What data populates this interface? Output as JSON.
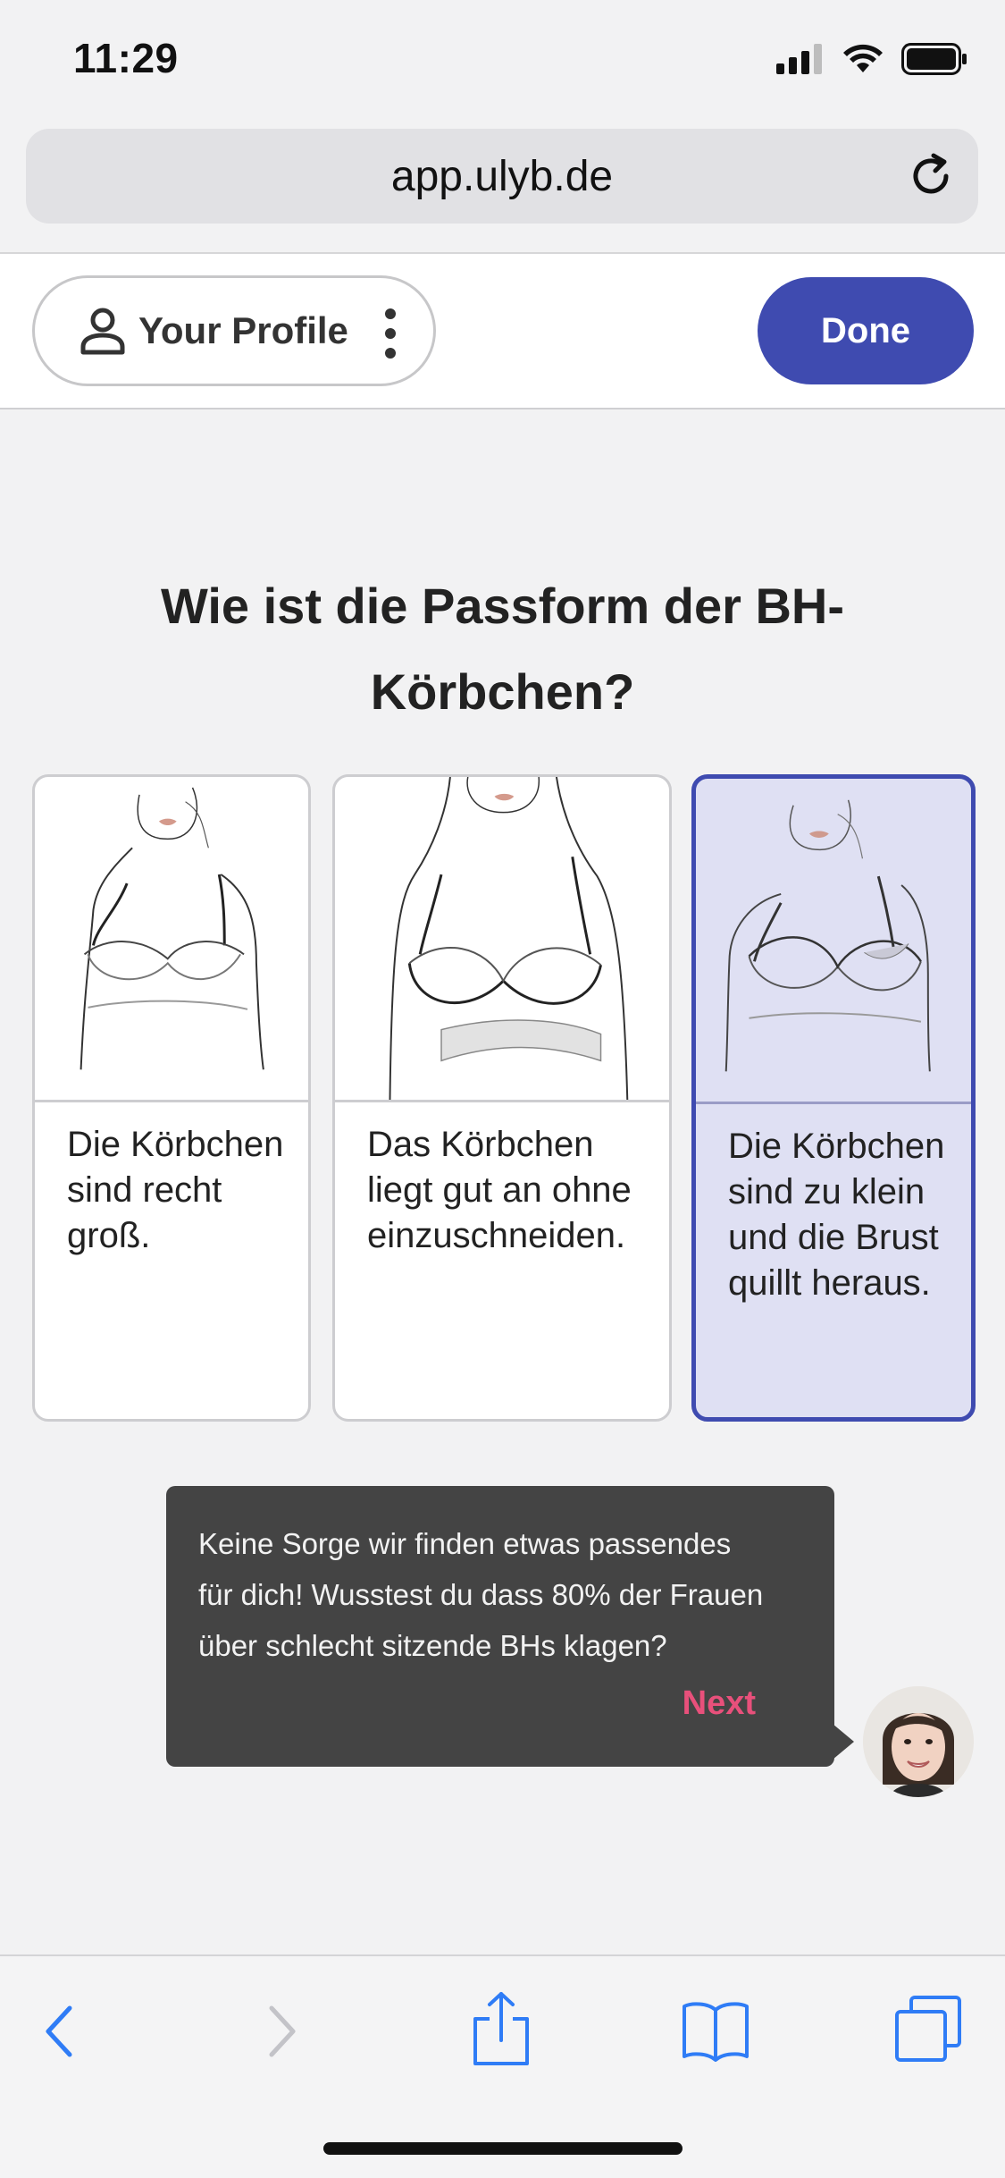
{
  "status_bar": {
    "time": "11:29"
  },
  "browser": {
    "url": "app.ulyb.de"
  },
  "header": {
    "profile_label": "Your Profile",
    "done_label": "Done"
  },
  "question": "Wie ist die Passform der BH-Körbchen?",
  "options": [
    {
      "text": "Die Körbchen sind recht groß.",
      "selected": false
    },
    {
      "text": "Das Körbchen liegt gut an ohne einzuschneiden.",
      "selected": false
    },
    {
      "text": "Die Körbchen sind zu klein und die Brust quillt heraus.",
      "selected": true
    }
  ],
  "tooltip": {
    "message": "Keine Sorge wir finden etwas passendes für dich! Wusstest du dass 80% der Frauen über schlecht sitzende BHs klagen?",
    "next_label": "Next"
  },
  "colors": {
    "accent": "#3f4bb0",
    "next": "#e8507b",
    "tooltip_bg": "#444444",
    "selected_bg": "#dfe0f3"
  },
  "icons": [
    "signal-icon",
    "wifi-icon",
    "battery-icon",
    "reload-icon",
    "user-icon",
    "kebab-icon",
    "back-icon",
    "forward-icon",
    "share-icon",
    "bookmarks-icon",
    "tabs-icon"
  ]
}
